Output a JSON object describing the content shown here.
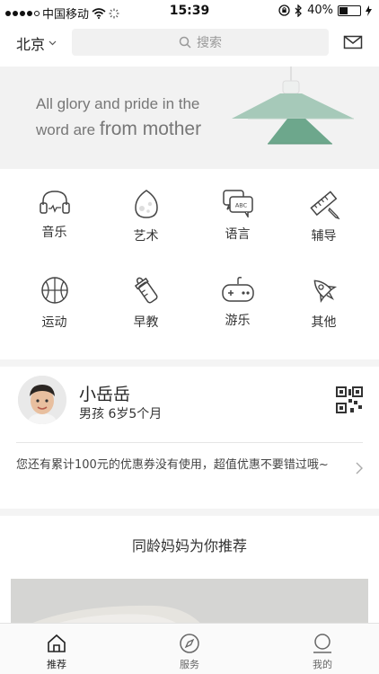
{
  "status_bar": {
    "carrier": "中国移动",
    "time": "15:39",
    "battery": "40%",
    "battery_level": 0.4
  },
  "topbar": {
    "city": "北京",
    "search_placeholder": "搜索"
  },
  "banner": {
    "line1": "All glory and pride in the",
    "line2_prefix": "word are",
    "line2_big": "from mother"
  },
  "categories": [
    {
      "label": "音乐",
      "icon": "headphones-icon"
    },
    {
      "label": "艺术",
      "icon": "egg-icon"
    },
    {
      "label": "语言",
      "icon": "abc-chat-icon"
    },
    {
      "label": "辅导",
      "icon": "ruler-pencil-icon"
    },
    {
      "label": "运动",
      "icon": "basketball-icon"
    },
    {
      "label": "早教",
      "icon": "baby-bottle-icon"
    },
    {
      "label": "游乐",
      "icon": "gamepad-icon"
    },
    {
      "label": "其他",
      "icon": "rocket-icon"
    }
  ],
  "profile": {
    "name": "小岳岳",
    "info": "男孩  6岁5个月"
  },
  "coupon": {
    "text": "您还有累计100元的优惠券没有使用，超值优惠不要错过哦~"
  },
  "recommend": {
    "title": "同龄妈妈为你推荐"
  },
  "tabbar": [
    {
      "label": "推荐",
      "icon": "home-icon",
      "active": true
    },
    {
      "label": "服务",
      "icon": "compass-icon",
      "active": false
    },
    {
      "label": "我的",
      "icon": "user-icon",
      "active": false
    }
  ]
}
